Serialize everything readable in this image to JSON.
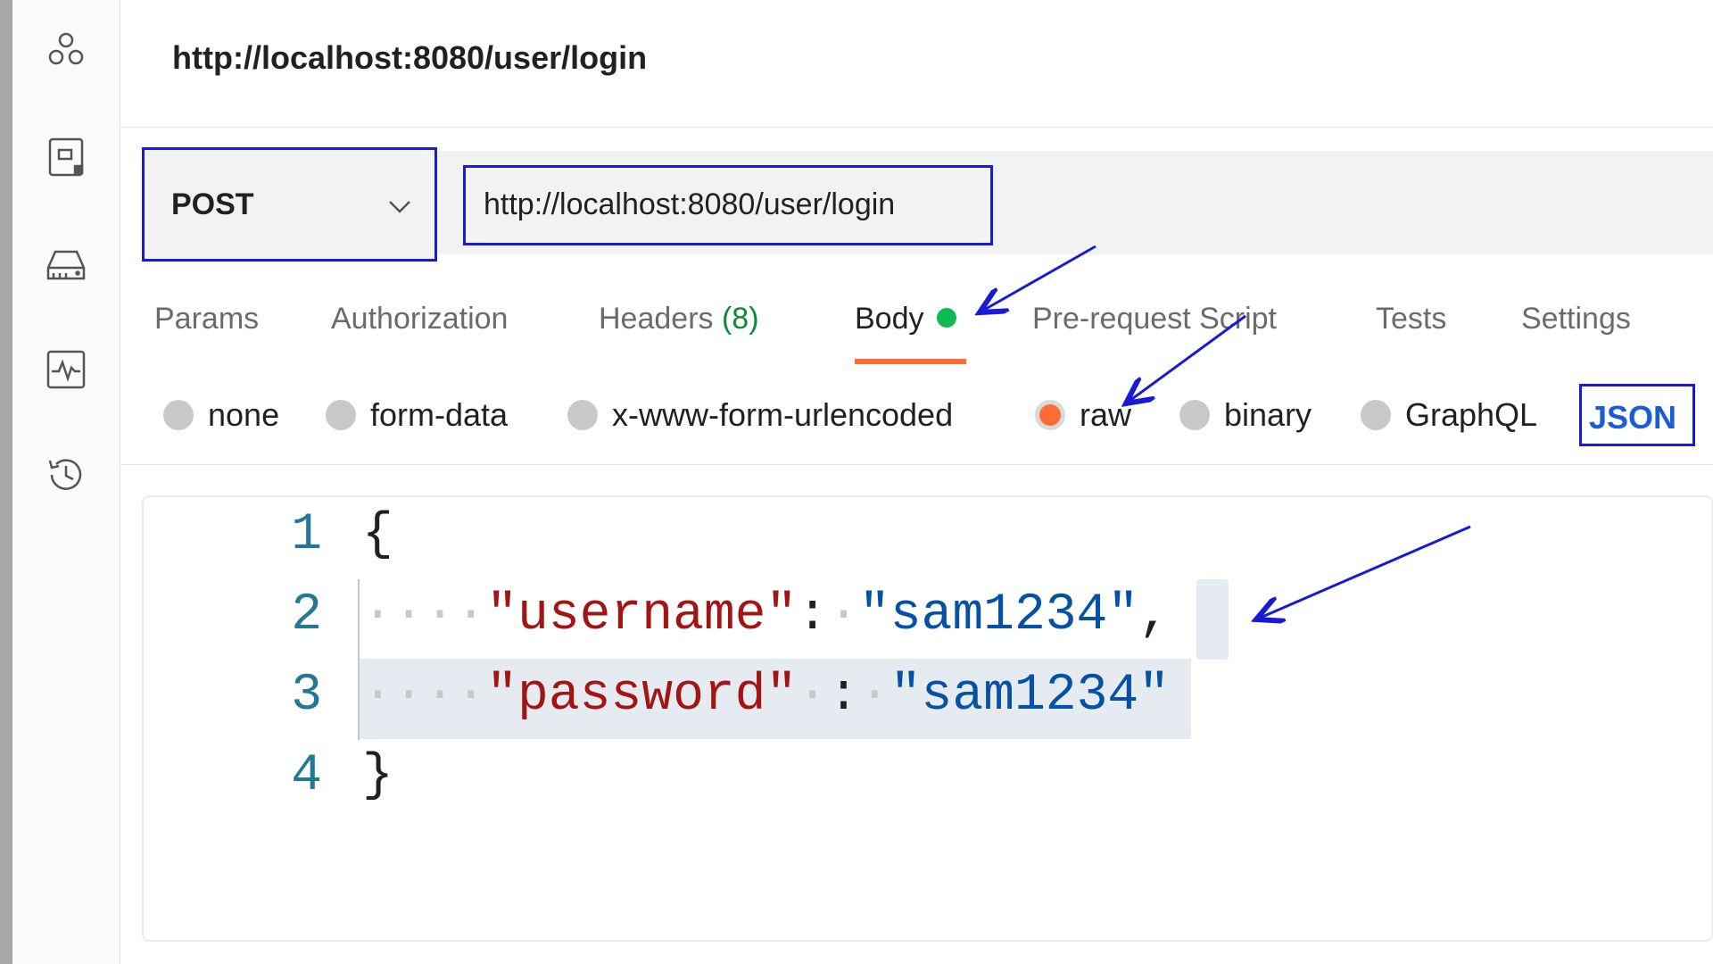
{
  "request": {
    "title": "http://localhost:8080/user/login",
    "method": "POST",
    "url": "http://localhost:8080/user/login"
  },
  "sidebar": {
    "icons": [
      "apis-icon",
      "environments-icon",
      "mock-servers-icon",
      "monitors-icon",
      "history-icon"
    ]
  },
  "tabs": {
    "params": "Params",
    "authorization": "Authorization",
    "headers": "Headers",
    "headers_count": "(8)",
    "body": "Body",
    "prerequest": "Pre-request Script",
    "tests": "Tests",
    "settings": "Settings",
    "active": "Body"
  },
  "body_types": {
    "none": "none",
    "form_data": "form-data",
    "urlencoded": "x-www-form-urlencoded",
    "raw": "raw",
    "binary": "binary",
    "graphql": "GraphQL",
    "selected": "raw",
    "format": "JSON"
  },
  "editor": {
    "line_numbers": [
      "1",
      "2",
      "3",
      "4"
    ],
    "open_brace": "{",
    "close_brace": "}",
    "username_key": "\"username\"",
    "username_value": "\"sam1234\"",
    "password_key": "\"password\"",
    "password_value": "\"sam1234\""
  },
  "colors": {
    "accent": "#ff6c37",
    "annotation": "#1a1ad6",
    "status_dot": "#0cbb52"
  }
}
